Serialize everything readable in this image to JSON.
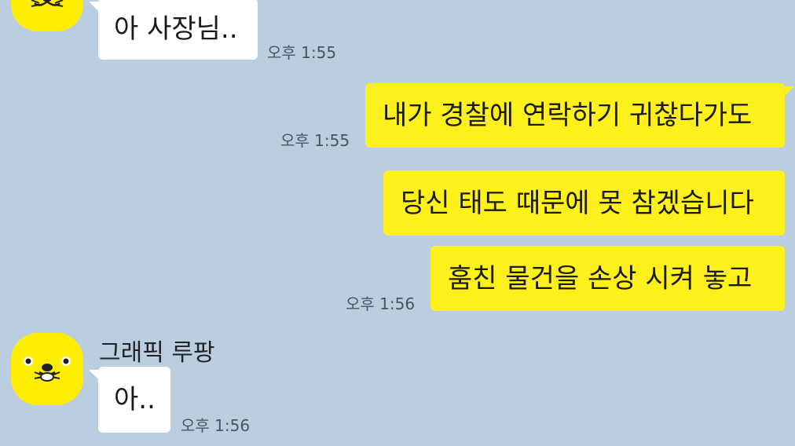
{
  "chat": {
    "messages": [
      {
        "direction": "incoming",
        "text": "아 사장님..",
        "time": "오후 1:55"
      },
      {
        "direction": "outgoing",
        "text": "내가 경찰에 연락하기 귀찮다가도",
        "time": "오후 1:55"
      },
      {
        "direction": "outgoing",
        "text": "당신 태도 때문에 못 참겠습니다",
        "time": ""
      },
      {
        "direction": "outgoing",
        "text": "훔친 물건을 손상 시켜 놓고",
        "time": "오후 1:56"
      },
      {
        "direction": "incoming",
        "sender": "그래픽 루팡",
        "text": "아..",
        "time": "오후 1:56"
      }
    ]
  },
  "colors": {
    "background": "#bacee0",
    "outgoing_bubble": "#fef01b",
    "incoming_bubble": "#ffffff",
    "avatar": "#ffee00"
  },
  "icons": {
    "avatar": "seal-avatar-icon"
  }
}
